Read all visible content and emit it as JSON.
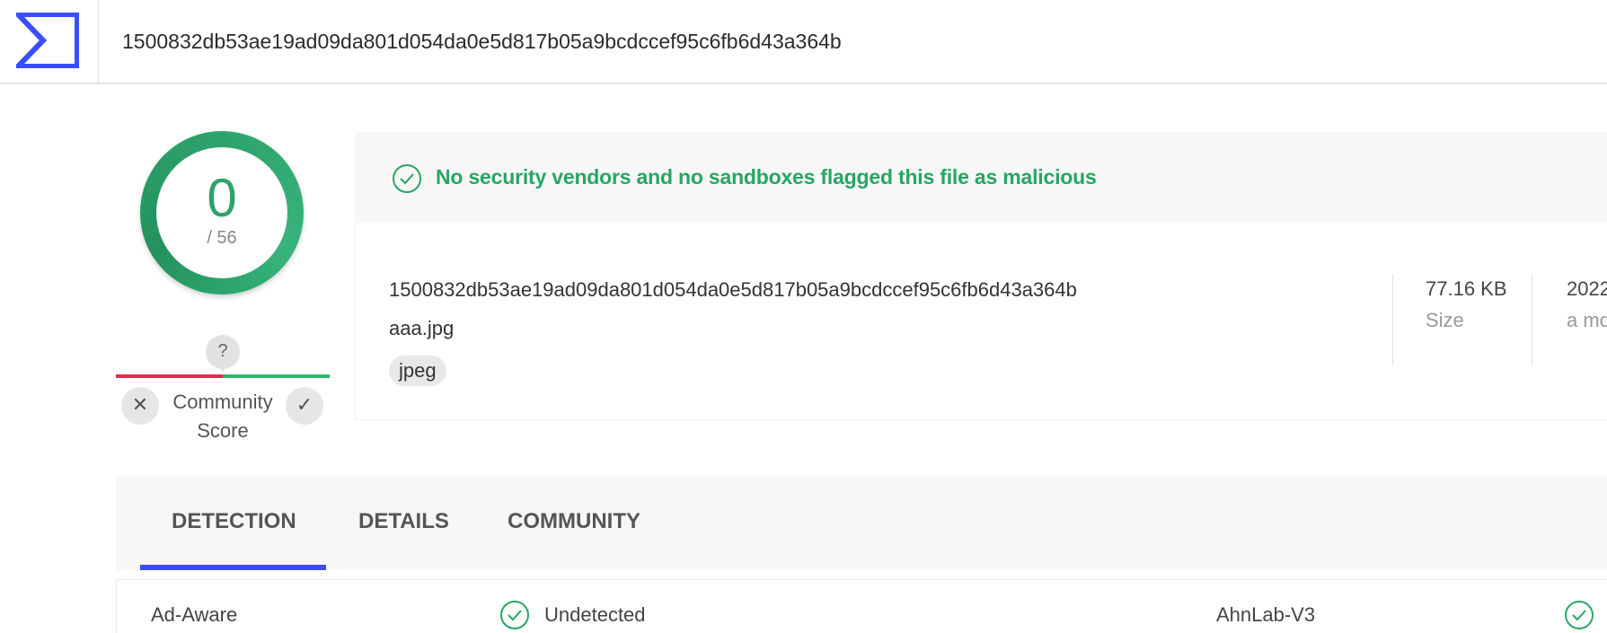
{
  "header": {
    "logo_icon": "virustotal-sigma-logo-icon",
    "search_value": "1500832db53ae19ad09da801d054da0e5d817b05a9bcdccef95c6fb6d43a364b",
    "accent_color": "#394EFF"
  },
  "score": {
    "detections": "0",
    "total": "/ 56",
    "color": "#2EA36C"
  },
  "community": {
    "marker": "?",
    "label_line1": "Community",
    "label_line2": "Score",
    "downvote_icon": "close-icon",
    "upvote_icon": "check-icon"
  },
  "banner": {
    "icon": "check-circle-icon",
    "message": "No security vendors and no sandboxes flagged this file as malicious",
    "color": "#27A664"
  },
  "file": {
    "hash": "1500832db53ae19ad09da801d054da0e5d817b05a9bcdccef95c6fb6d43a364b",
    "name": "aaa.jpg",
    "tag": "jpeg",
    "size_value": "77.16 KB",
    "size_label": "Size",
    "date_value": "2022",
    "date_label": "a mo"
  },
  "tabs": [
    {
      "label": "DETECTION",
      "active": true
    },
    {
      "label": "DETAILS",
      "active": false
    },
    {
      "label": "COMMUNITY",
      "active": false
    }
  ],
  "detections": [
    {
      "vendor": "Ad-Aware",
      "result": "Undetected",
      "icon": "check-circle-icon"
    },
    {
      "vendor": "AhnLab-V3",
      "result": "",
      "icon": "check-circle-icon"
    }
  ]
}
